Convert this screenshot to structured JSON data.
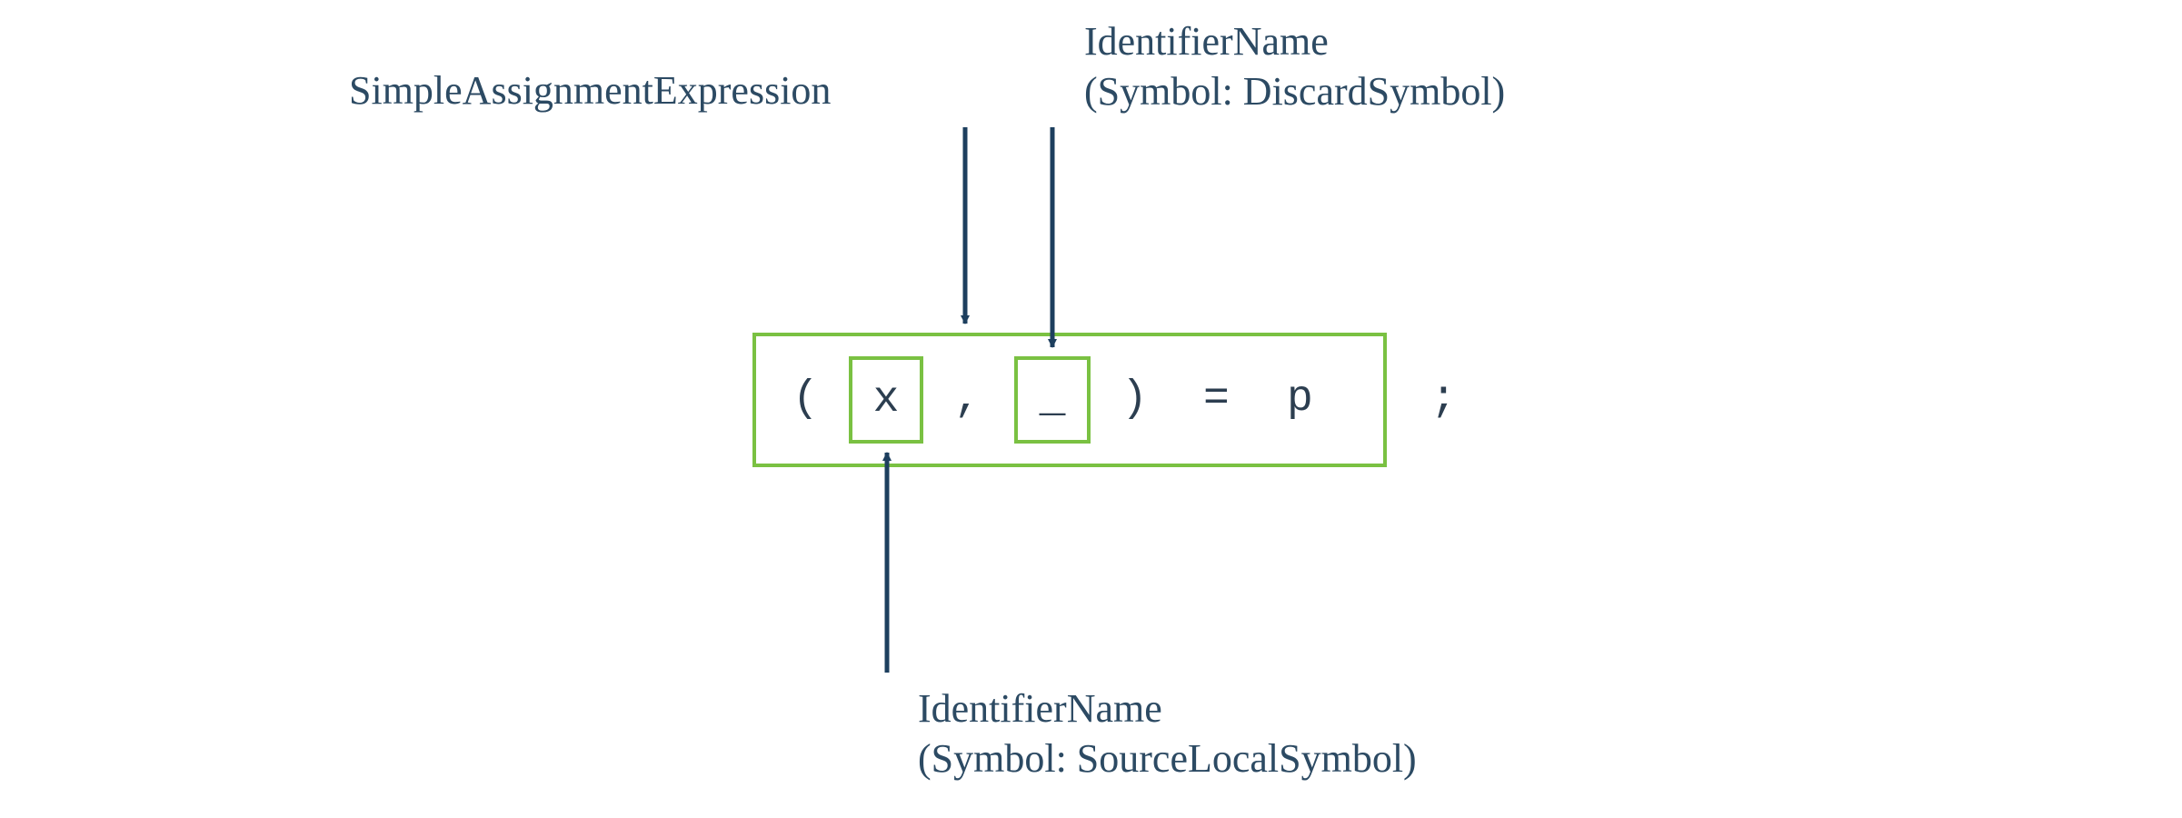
{
  "labels": {
    "top_left": "SimpleAssignmentExpression",
    "top_right_line1": "IdentifierName",
    "top_right_line2": "(Symbol: DiscardSymbol)",
    "bottom_line1": "IdentifierName",
    "bottom_line2": "(Symbol: SourceLocalSymbol)"
  },
  "code": {
    "open_paren": "(",
    "x": "x",
    "comma": ",",
    "underscore": "_",
    "close_paren": ")",
    "eq": "=",
    "p": "p",
    "semi": ";"
  },
  "colors": {
    "border": "#7ac142",
    "text": "#2c4a63",
    "arrow": "#1d3f5e"
  }
}
